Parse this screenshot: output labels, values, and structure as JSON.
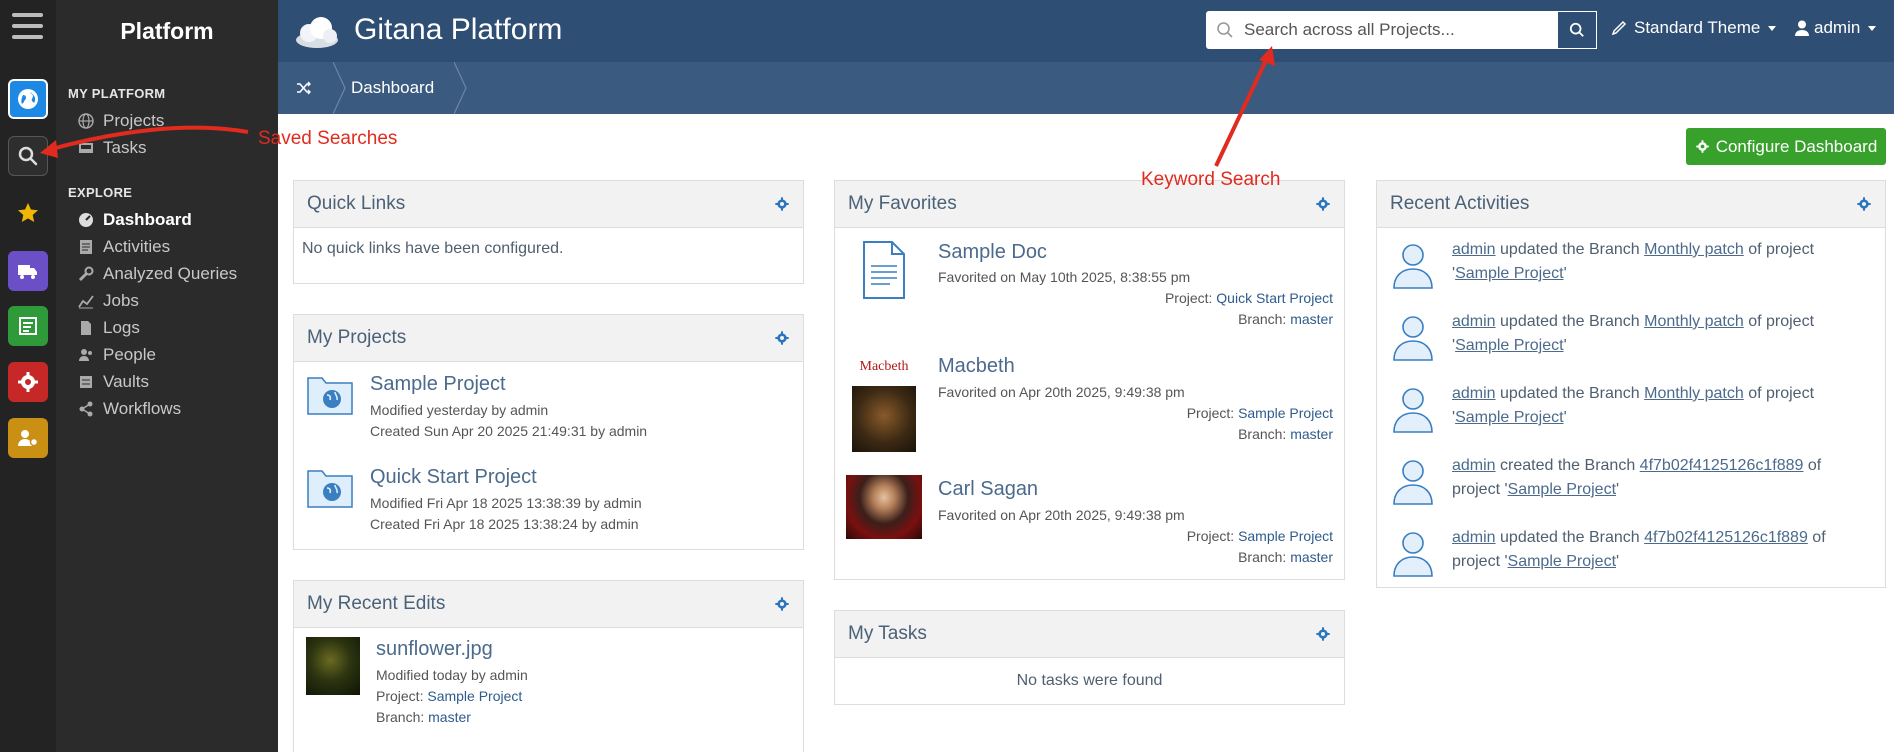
{
  "sidebar": {
    "title": "Platform",
    "sections": [
      {
        "heading": "MY PLATFORM",
        "items": [
          "Projects",
          "Tasks"
        ]
      },
      {
        "heading": "EXPLORE",
        "items": [
          "Dashboard",
          "Activities",
          "Analyzed Queries",
          "Jobs",
          "Logs",
          "People",
          "Vaults",
          "Workflows"
        ]
      }
    ],
    "active_item": "Dashboard"
  },
  "header": {
    "brand": "Gitana Platform",
    "search_placeholder": "Search across all Projects...",
    "theme_label": "Standard Theme",
    "user_label": "admin"
  },
  "breadcrumb": {
    "current": "Dashboard"
  },
  "configure_label": "Configure Dashboard",
  "panels": {
    "quick_links": {
      "title": "Quick Links",
      "empty": "No quick links have been configured."
    },
    "my_projects": {
      "title": "My Projects",
      "items": [
        {
          "name": "Sample Project",
          "modified": "Modified yesterday by admin",
          "created": "Created Sun Apr 20 2025 21:49:31 by admin"
        },
        {
          "name": "Quick Start Project",
          "modified": "Modified Fri Apr 18 2025 13:38:39 by admin",
          "created": "Created Fri Apr 18 2025 13:38:24 by admin"
        }
      ]
    },
    "recent_edits": {
      "title": "My Recent Edits",
      "items": [
        {
          "name": "sunflower.jpg",
          "modified": "Modified today by admin",
          "project_label": "Project:",
          "project": "Sample Project",
          "branch_label": "Branch:",
          "branch": "master"
        }
      ]
    },
    "favorites": {
      "title": "My Favorites",
      "items": [
        {
          "name": "Sample Doc",
          "favorited": "Favorited on May 10th 2025, 8:38:55 pm",
          "project_label": "Project:",
          "project": "Quick Start Project",
          "branch_label": "Branch:",
          "branch": "master"
        },
        {
          "name": "Macbeth",
          "favorited": "Favorited on Apr 20th 2025, 9:49:38 pm",
          "project_label": "Project:",
          "project": "Sample Project",
          "branch_label": "Branch:",
          "branch": "master",
          "cover_text": "Macbeth"
        },
        {
          "name": "Carl Sagan",
          "favorited": "Favorited on Apr 20th 2025, 9:49:38 pm",
          "project_label": "Project:",
          "project": "Sample Project",
          "branch_label": "Branch:",
          "branch": "master"
        }
      ]
    },
    "tasks": {
      "title": "My Tasks",
      "empty": "No tasks were found"
    },
    "activities": {
      "title": "Recent Activities",
      "items": [
        {
          "user": "admin",
          "verb": " updated the Branch ",
          "branch": "Monthly patch",
          "mid": " of project",
          "quote_open": "'",
          "project": "Sample Project",
          "quote_close": "'"
        },
        {
          "user": "admin",
          "verb": " updated the Branch ",
          "branch": "Monthly patch",
          "mid": " of project",
          "quote_open": "'",
          "project": "Sample Project",
          "quote_close": "'"
        },
        {
          "user": "admin",
          "verb": " updated the Branch ",
          "branch": "Monthly patch",
          "mid": " of project",
          "quote_open": "'",
          "project": "Sample Project",
          "quote_close": "'"
        },
        {
          "user": "admin",
          "verb": " created the Branch ",
          "branch": "4f7b02f4125126c1f889",
          "mid": " of",
          "quote_open": "project '",
          "project": "Sample Project",
          "quote_close": "'"
        },
        {
          "user": "admin",
          "verb": " updated the Branch ",
          "branch": "4f7b02f4125126c1f889",
          "mid": " of",
          "quote_open": "project '",
          "project": "Sample Project",
          "quote_close": "'"
        }
      ]
    }
  },
  "annotations": {
    "saved_searches": "Saved Searches",
    "keyword_search": "Keyword Search"
  },
  "colors": {
    "header": "#2f4e73",
    "rail": "#232323",
    "nav": "#2b2b2b",
    "configure": "#37a12c",
    "annotation": "#e12b1e"
  },
  "rail_icons": [
    "globe-icon",
    "search-icon",
    "star-icon",
    "truck-icon",
    "list-icon",
    "gear-icon",
    "user-gear-icon"
  ]
}
